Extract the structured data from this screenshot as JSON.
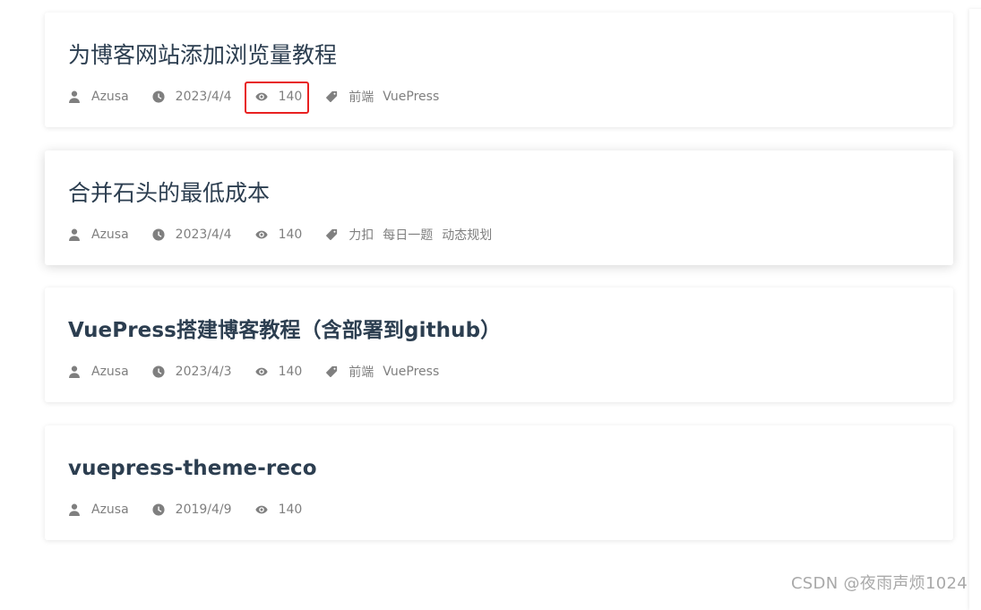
{
  "posts": [
    {
      "title": "为博客网站添加浏览量教程",
      "author": "Azusa",
      "date": "2023/4/4",
      "views": "140",
      "tags": [
        "前端",
        "VuePress"
      ]
    },
    {
      "title": "合并石头的最低成本",
      "author": "Azusa",
      "date": "2023/4/4",
      "views": "140",
      "tags": [
        "力扣",
        "每日一题",
        "动态规划"
      ]
    },
    {
      "title": "VuePress搭建博客教程（含部署到github）",
      "author": "Azusa",
      "date": "2023/4/3",
      "views": "140",
      "tags": [
        "前端",
        "VuePress"
      ]
    },
    {
      "title": "vuepress-theme-reco",
      "author": "Azusa",
      "date": "2019/4/9",
      "views": "140",
      "tags": []
    }
  ],
  "watermark": "CSDN @夜雨声烦1024",
  "colors": {
    "title": "#2c3e50",
    "meta": "#7f7f7f",
    "highlight": "#e82020"
  },
  "icons": {
    "author": "user-icon",
    "date": "clock-icon",
    "views": "eye-icon",
    "tags": "tag-icon"
  }
}
